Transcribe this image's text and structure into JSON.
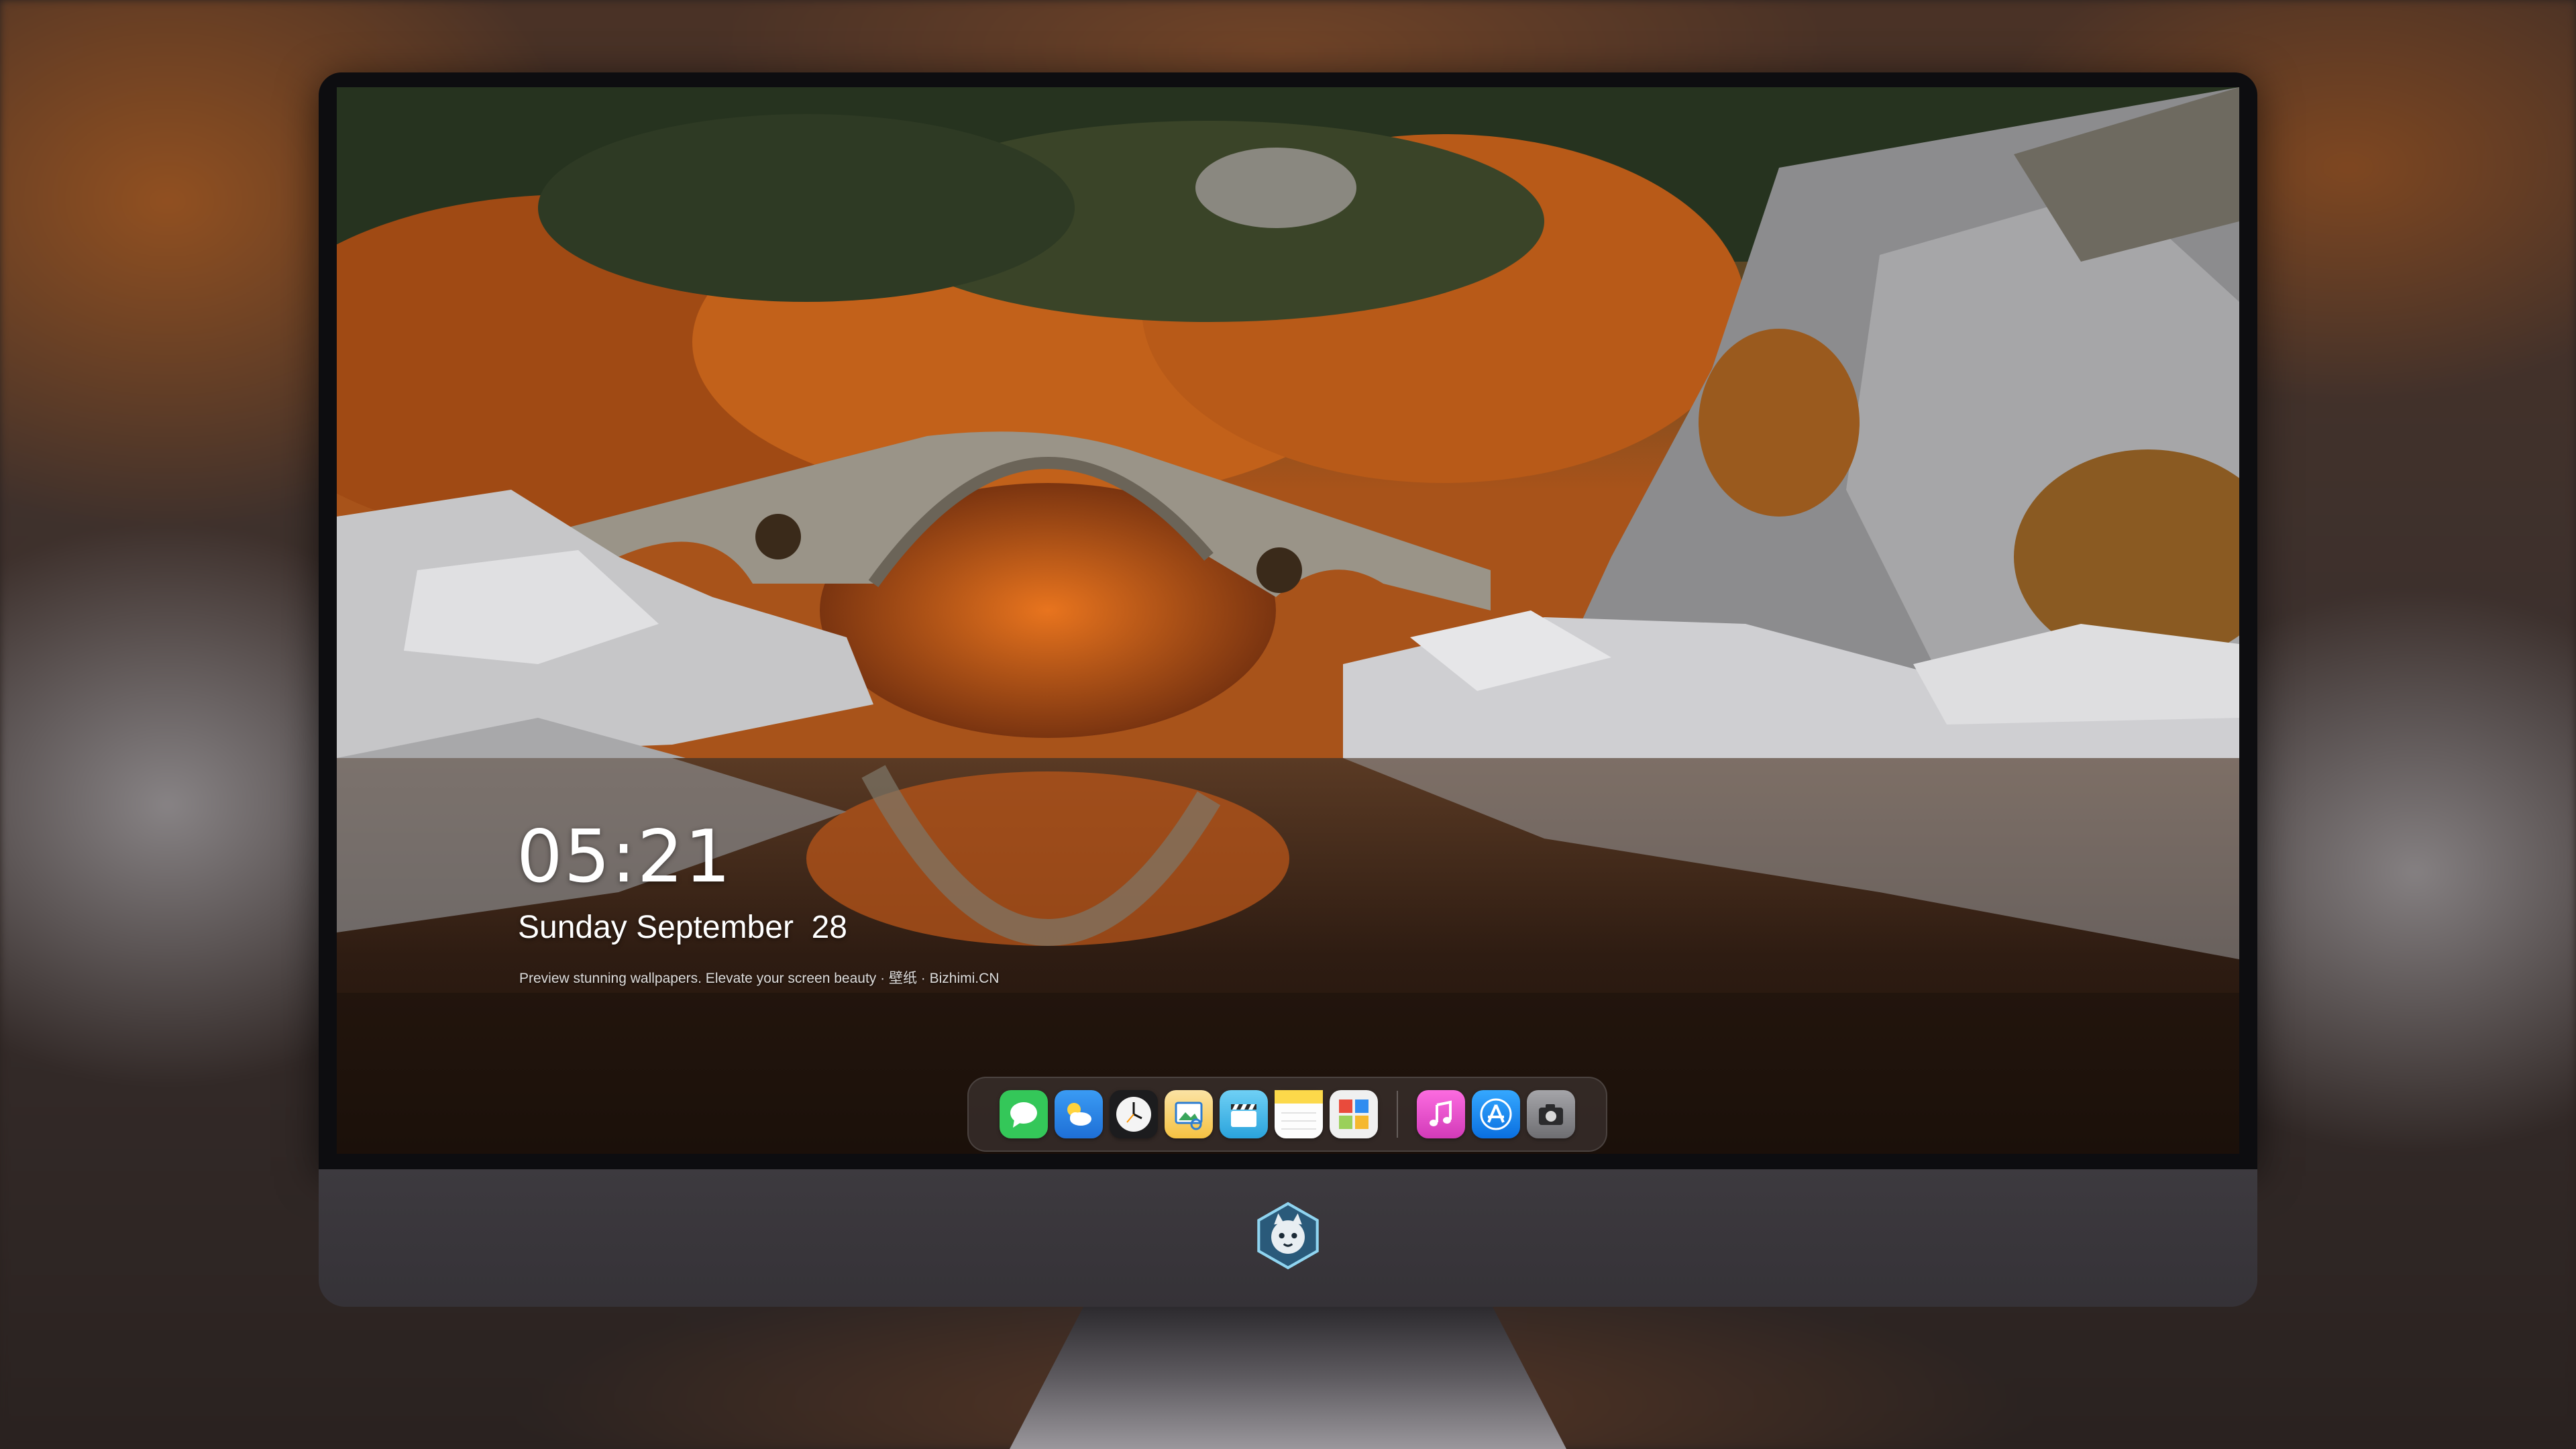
{
  "lock_screen": {
    "time": "05:21",
    "date": "Sunday September  28",
    "caption": "Preview stunning wallpapers. Elevate your screen beauty · 壁纸 · Bizhimi.CN"
  },
  "dock": {
    "apps": [
      {
        "name": "Messages",
        "icon": "message-bubble-icon",
        "color": "#34c759"
      },
      {
        "name": "Weather",
        "icon": "cloud-sun-icon",
        "color": "#2f8cf0"
      },
      {
        "name": "Clock",
        "icon": "clock-icon",
        "color": "#f2f2f2"
      },
      {
        "name": "Preview",
        "icon": "image-preview-icon",
        "color": "#f5c242"
      },
      {
        "name": "Clips",
        "icon": "clapperboard-icon",
        "color": "#35b7e6"
      },
      {
        "name": "Notes",
        "icon": "notepad-icon",
        "color": "#fcd94a"
      },
      {
        "name": "Photo Booth",
        "icon": "photo-grid-icon",
        "color": "#9ad05a"
      },
      {
        "name": "Music",
        "icon": "music-note-icon",
        "color": "#fb5fd0"
      },
      {
        "name": "App Store",
        "icon": "app-store-icon",
        "color": "#1a8cf5"
      },
      {
        "name": "Screenshot",
        "icon": "camera-icon",
        "color": "#8a8a8e"
      }
    ]
  },
  "colors": {
    "foliage": "#c8661c",
    "rock": "#cfcfd2",
    "water": "#3a2418",
    "bezel": "#0d0d10",
    "chin": "#3a373c"
  }
}
